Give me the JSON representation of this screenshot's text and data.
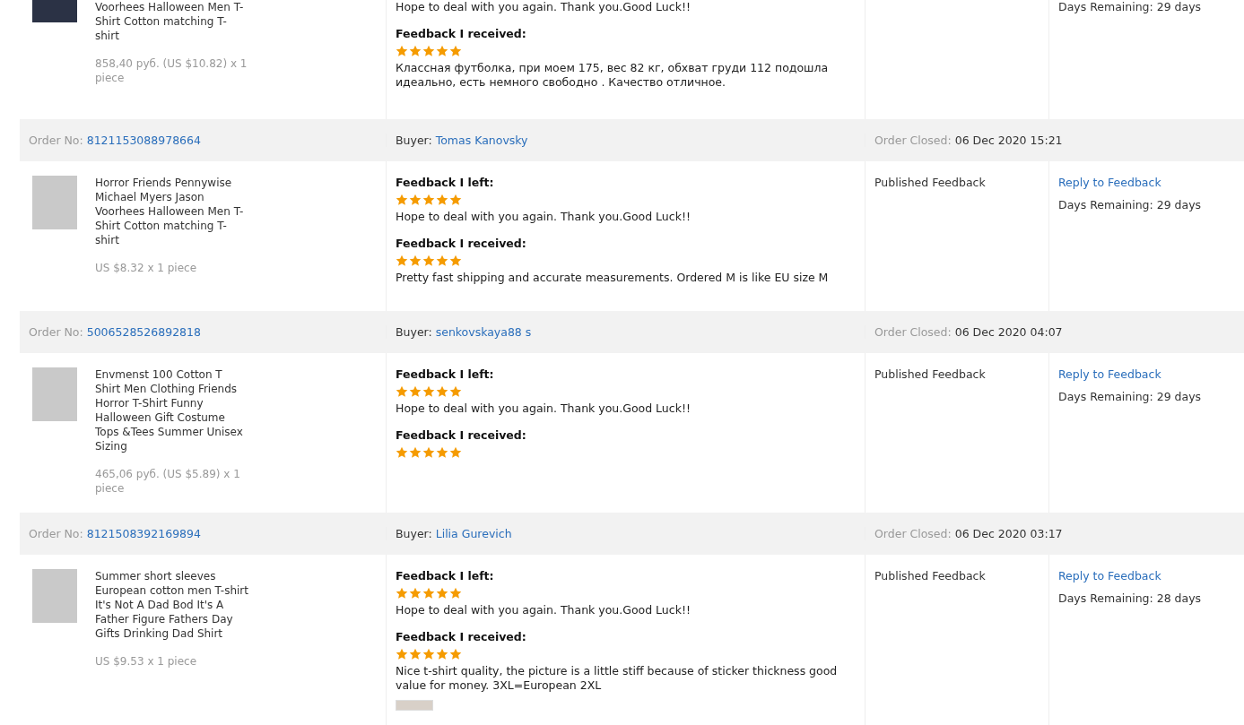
{
  "orders": [
    {
      "product": {
        "title": "Voorhees Halloween Men T-Shirt Cotton matching T-shirt",
        "price": "858,40 руб. (US $10.82) x 1 piece"
      },
      "feedback_left": {
        "text": "Hope to deal with you again. Thank you.Good Luck!!"
      },
      "feedback_received": {
        "label": "Feedback I received:",
        "stars": 5,
        "text": "Классная футболка, при моем 175, вес 82 кг, обхват груди 112 подошла идеально, есть немного свободно . Качество отличное."
      },
      "days_remaining": "Days Remaining: 29 days"
    },
    {
      "header": {
        "order_label": "Order No:",
        "order_no": "8121153088978664",
        "buyer_label": "Buyer:",
        "buyer": "Tomas Kanovsky",
        "closed_label": "Order Closed:",
        "closed": "06 Dec 2020 15:21"
      },
      "product": {
        "title": "Horror Friends Pennywise Michael Myers Jason Voorhees Halloween Men T-Shirt Cotton matching T-shirt",
        "price": "US $8.32 x 1 piece"
      },
      "feedback_left": {
        "label": "Feedback I left:",
        "stars": 5,
        "text": "Hope to deal with you again. Thank you.Good Luck!!"
      },
      "feedback_received": {
        "label": "Feedback I received:",
        "stars": 5,
        "text": "Pretty fast shipping and accurate measurements. Ordered M is like EU size M"
      },
      "status": "Published Feedback",
      "reply_link": "Reply to Feedback",
      "days_remaining": "Days Remaining: 29 days"
    },
    {
      "header": {
        "order_label": "Order No:",
        "order_no": "5006528526892818",
        "buyer_label": "Buyer:",
        "buyer": "senkovskaya88 s",
        "closed_label": "Order Closed:",
        "closed": "06 Dec 2020 04:07"
      },
      "product": {
        "title": "Envmenst 100 Cotton T Shirt Men Clothing Friends Horror T-Shirt Funny Halloween Gift Costume Tops &Tees Summer Unisex Sizing",
        "price": "465,06 руб. (US $5.89) x 1 piece"
      },
      "feedback_left": {
        "label": "Feedback I left:",
        "stars": 5,
        "text": "Hope to deal with you again. Thank you.Good Luck!!"
      },
      "feedback_received": {
        "label": "Feedback I received:",
        "stars": 5
      },
      "status": "Published Feedback",
      "reply_link": "Reply to Feedback",
      "days_remaining": "Days Remaining: 29 days"
    },
    {
      "header": {
        "order_label": "Order No:",
        "order_no": "8121508392169894",
        "buyer_label": "Buyer:",
        "buyer": "Lilia Gurevich",
        "closed_label": "Order Closed:",
        "closed": "06 Dec 2020 03:17"
      },
      "product": {
        "title": "Summer short sleeves European cotton men T-shirt It's Not A Dad Bod It's A Father Figure Fathers Day Gifts Drinking Dad Shirt",
        "price": "US $9.53 x 1 piece"
      },
      "feedback_left": {
        "label": "Feedback I left:",
        "stars": 5,
        "text": "Hope to deal with you again. Thank you.Good Luck!!"
      },
      "feedback_received": {
        "label": "Feedback I received:",
        "stars": 5,
        "text": "Nice t-shirt quality, the picture is a little stiff because of sticker thickness good value for money. 3XL=European 2XL",
        "photo": true
      },
      "status": "Published Feedback",
      "reply_link": "Reply to Feedback",
      "days_remaining": "Days Remaining: 28 days"
    }
  ]
}
